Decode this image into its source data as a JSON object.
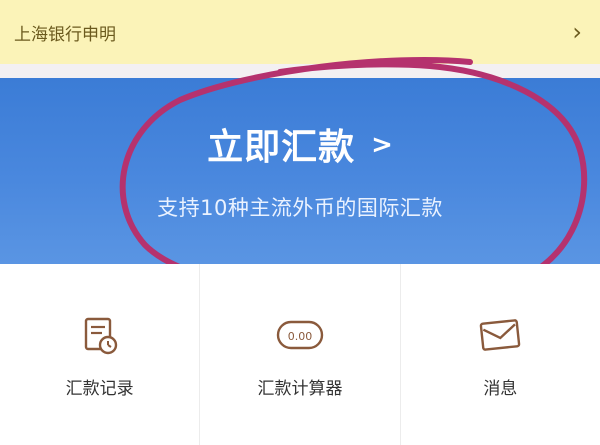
{
  "notice": {
    "text": "上海银行申明",
    "chevron_icon": "chevron-right-icon"
  },
  "banner": {
    "title": "立即汇款",
    "arrow": ">",
    "subtitle": "支持10种主流外币的国际汇款"
  },
  "grid": {
    "items": [
      {
        "label": "汇款记录",
        "icon": "document-clock-icon"
      },
      {
        "label": "汇款计算器",
        "icon": "calculator-display-icon",
        "display_value": "0.00"
      },
      {
        "label": "消息",
        "icon": "envelope-icon"
      }
    ]
  },
  "colors": {
    "notice_bg": "#fbf3b8",
    "banner_blue": "#4a88de",
    "annotation_circle": "#b5326e",
    "icon_brown": "#8a5a3c"
  }
}
